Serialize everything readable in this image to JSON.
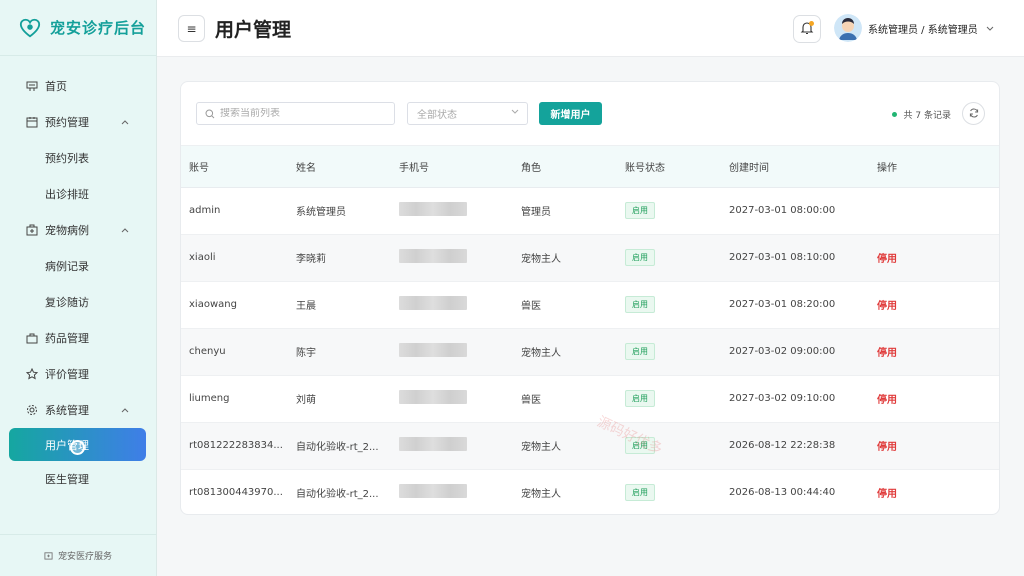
{
  "brand": {
    "title": "宠安诊疗后台"
  },
  "sidebar": {
    "items": [
      {
        "label": "首页",
        "icon": "home-icon"
      },
      {
        "label": "预约管理",
        "icon": "calendar-icon"
      },
      {
        "label": "预约列表"
      },
      {
        "label": "出诊排班"
      },
      {
        "label": "宠物病例",
        "icon": "medical-case-icon"
      },
      {
        "label": "病例记录"
      },
      {
        "label": "复诊随访"
      },
      {
        "label": "药品管理",
        "icon": "bag-icon"
      },
      {
        "label": "评价管理",
        "icon": "star-icon"
      },
      {
        "label": "系统管理",
        "icon": "gear-icon"
      },
      {
        "label": "用户管理"
      },
      {
        "label": "医生管理"
      }
    ],
    "footer": "宠安医疗服务"
  },
  "header": {
    "title": "用户管理",
    "user": "系统管理员 / 系统管理员"
  },
  "toolbar": {
    "search_placeholder": "搜索当前列表",
    "status_select": "全部状态",
    "add_button": "新增用户",
    "count_text": "共 7 条记录"
  },
  "table": {
    "columns": [
      "账号",
      "姓名",
      "手机号",
      "角色",
      "账号状态",
      "创建时间",
      "操作"
    ],
    "rows": [
      {
        "account": "admin",
        "name": "系统管理员",
        "role": "管理员",
        "status": "启用",
        "created": "2027-03-01 08:00:00",
        "action": ""
      },
      {
        "account": "xiaoli",
        "name": "李晓莉",
        "role": "宠物主人",
        "status": "启用",
        "created": "2027-03-01 08:10:00",
        "action": "停用"
      },
      {
        "account": "xiaowang",
        "name": "王晨",
        "role": "兽医",
        "status": "启用",
        "created": "2027-03-01 08:20:00",
        "action": "停用"
      },
      {
        "account": "chenyu",
        "name": "陈宇",
        "role": "宠物主人",
        "status": "启用",
        "created": "2027-03-02 09:00:00",
        "action": "停用"
      },
      {
        "account": "liumeng",
        "name": "刘萌",
        "role": "兽医",
        "status": "启用",
        "created": "2027-03-02 09:10:00",
        "action": "停用"
      },
      {
        "account": "rt081222283834...",
        "name": "自动化验收-rt_2...",
        "role": "宠物主人",
        "status": "启用",
        "created": "2026-08-12 22:28:38",
        "action": "停用"
      },
      {
        "account": "rt081300443970...",
        "name": "自动化验收-rt_2...",
        "role": "宠物主人",
        "status": "启用",
        "created": "2026-08-13 00:44:40",
        "action": "停用"
      }
    ]
  },
  "watermark": "源码好优多",
  "colors": {
    "primary": "#14a39b",
    "danger": "#e03c3c",
    "success": "#1e9e5a",
    "sidebar_bg": "#e7f7f5"
  }
}
